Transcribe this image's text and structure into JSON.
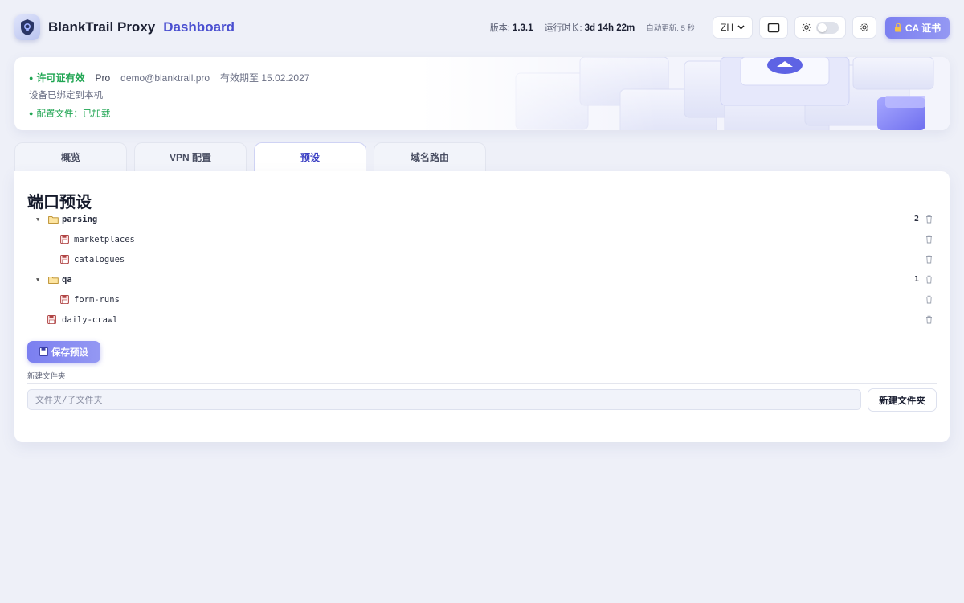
{
  "header": {
    "title": "BlankTrail Proxy",
    "subtitle": "Dashboard",
    "version_label": "版本:",
    "version": "1.3.1",
    "uptime_label": "运行时长:",
    "uptime": "3d 14h 22m",
    "autorefresh_label": "自动更新:",
    "autorefresh_value": "5 秒",
    "language": "ZH",
    "ca_button": "CA 证书"
  },
  "license": {
    "status": "许可证有效",
    "plan": "Pro",
    "email": "demo@blanktrail.pro",
    "expiry": "有效期至 15.02.2027",
    "device": "设备已绑定到本机",
    "config": "配置文件：已加载"
  },
  "tabs": [
    {
      "label": "概览",
      "active": false
    },
    {
      "label": "VPN 配置",
      "active": false
    },
    {
      "label": "预设",
      "active": true
    },
    {
      "label": "域名路由",
      "active": false
    }
  ],
  "panel": {
    "title": "端口预设",
    "tree": {
      "folder1": {
        "name": "parsing",
        "count": "2"
      },
      "item1": "marketplaces",
      "item2": "catalogues",
      "folder2": {
        "name": "qa",
        "count": "1"
      },
      "item3": "form-runs",
      "item4": "daily-crawl"
    },
    "save_button": "保存预设",
    "new_folder_label": "新建文件夹",
    "new_folder_placeholder": "文件夹/子文件夹",
    "new_folder_button": "新建文件夹"
  },
  "colors": {
    "accent": "#7b7ff0",
    "accent_text": "#4a4fd0",
    "success": "#1fa552",
    "background": "#eef0f8"
  }
}
